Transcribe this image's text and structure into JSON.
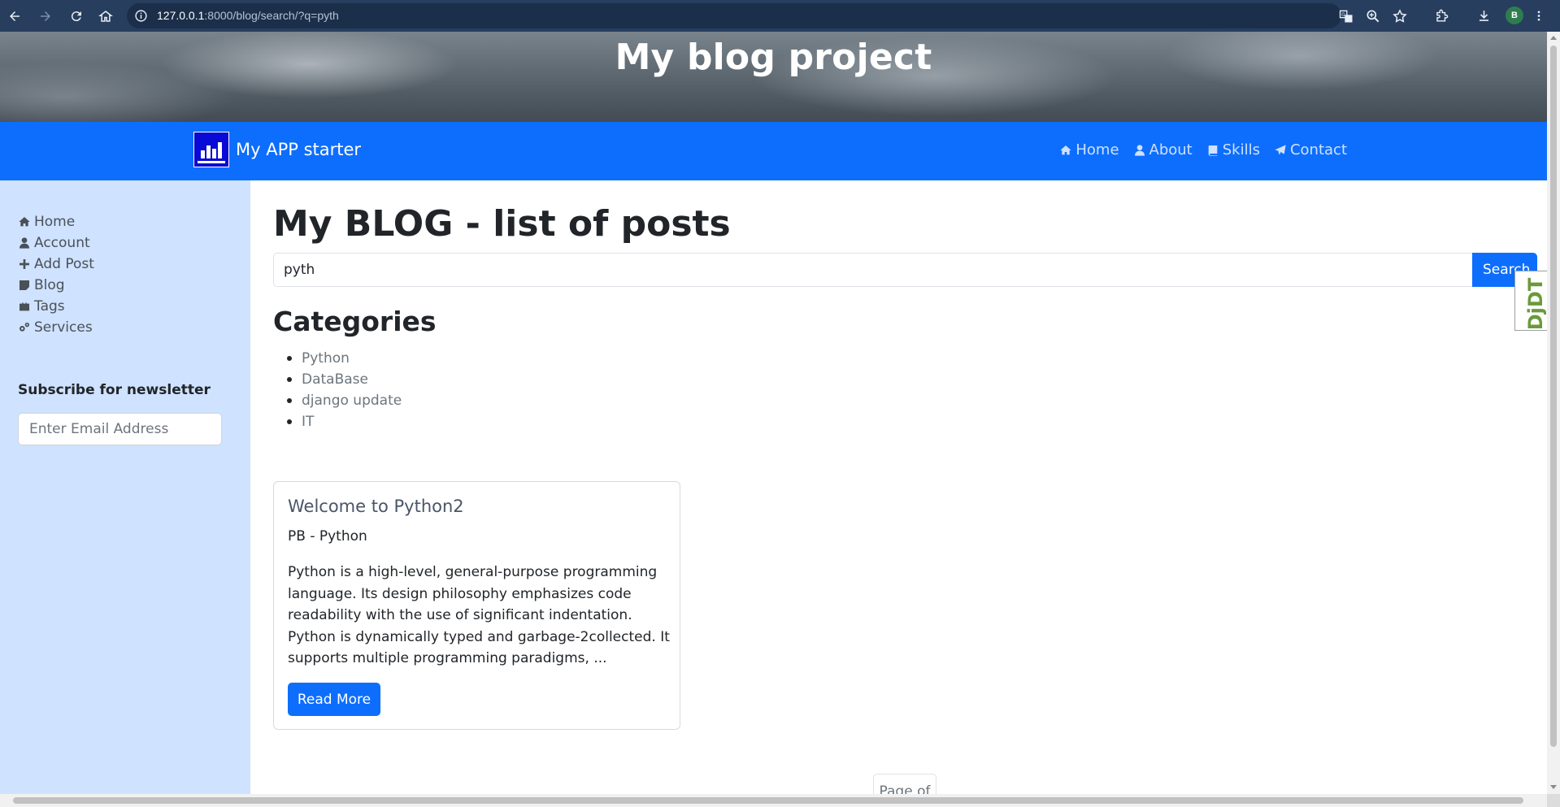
{
  "browser": {
    "url_host": "127.0.0.1",
    "url_rest": ":8000/blog/search/?q=pyth",
    "profile_initial": "B"
  },
  "hero": {
    "title": "My blog project"
  },
  "navbar": {
    "brand": "My APP starter",
    "links": [
      {
        "label": "Home",
        "icon": "home-icon"
      },
      {
        "label": "About",
        "icon": "user-icon"
      },
      {
        "label": "Skills",
        "icon": "book-icon"
      },
      {
        "label": "Contact",
        "icon": "paper-plane-icon"
      }
    ]
  },
  "sidebar": {
    "items": [
      {
        "label": "Home",
        "icon": "home-icon"
      },
      {
        "label": "Account",
        "icon": "user-icon"
      },
      {
        "label": "Add Post",
        "icon": "plus-icon"
      },
      {
        "label": "Blog",
        "icon": "sticky-note-icon"
      },
      {
        "label": "Tags",
        "icon": "briefcase-icon"
      },
      {
        "label": "Services",
        "icon": "cogs-icon"
      }
    ],
    "newsletter_title": "Subscribe for newsletter",
    "newsletter_placeholder": "Enter Email Address"
  },
  "main": {
    "title": "My BLOG - list of posts",
    "search_value": "pyth",
    "search_button": "Search",
    "categories_title": "Categories",
    "categories": [
      "Python",
      "DataBase",
      "django update",
      "IT"
    ],
    "post": {
      "title": "Welcome to Python2",
      "subtitle": "PB - Python",
      "excerpt": "Python is a high-level, general-purpose programming language. Its design philosophy emphasizes code readability with the use of significant indentation. Python is dynamically typed and garbage-2collected. It supports multiple programming paradigms, ...",
      "button": "Read More"
    },
    "pagination": "Page of"
  },
  "debug_toolbar": {
    "label": "DjDT"
  },
  "colors": {
    "primary": "#0d6efd",
    "sidebar_bg": "#cfe2ff",
    "chrome_bg": "#273e5e"
  }
}
